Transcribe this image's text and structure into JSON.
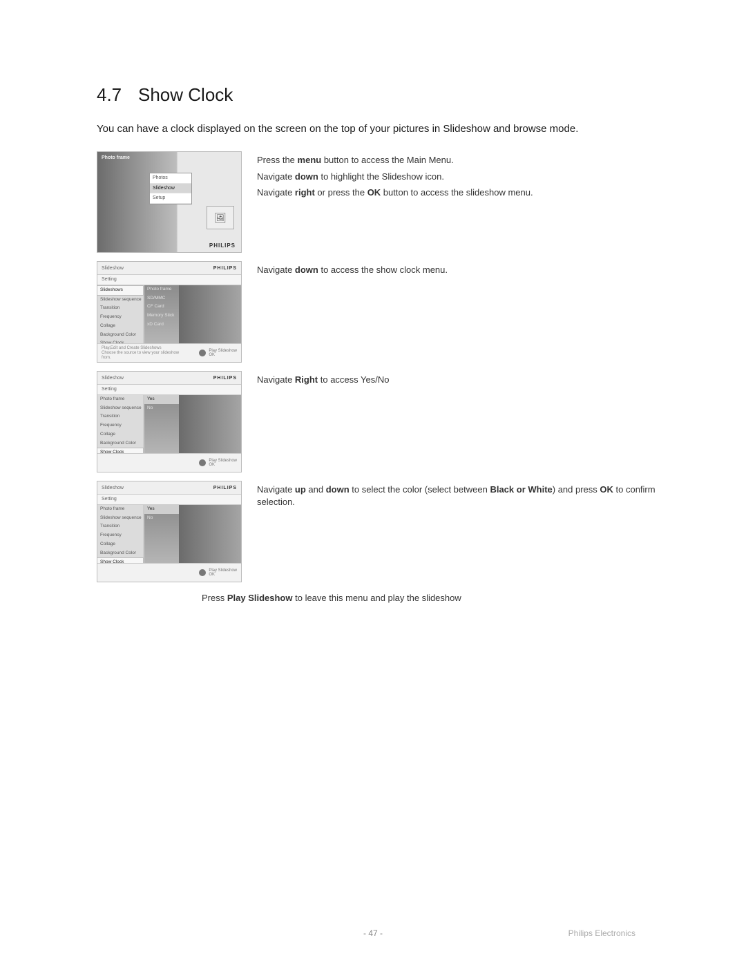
{
  "page": {
    "section_number": "4.7",
    "section_title": "Show Clock",
    "page_number": "- 47 -",
    "brand_footer": "Philips Electronics"
  },
  "intro": "You can have a clock displayed on the screen on the top of your pictures in Slideshow and browse mode.",
  "step1": {
    "l1a": "Press the ",
    "l1b": "menu",
    "l1c": " button to access the Main Menu.",
    "l2a": "Navigate ",
    "l2b": "down",
    "l2c": " to highlight the Slideshow icon.",
    "l3a": "Navigate ",
    "l3b": "right",
    "l3c": " or press the ",
    "l3d": "OK",
    "l3e": " button to access the slideshow menu."
  },
  "step2": {
    "a": "Navigate ",
    "b": "down",
    "c": " to access the show clock menu."
  },
  "step3": {
    "a": "Navigate ",
    "b": "Right",
    "c": " to access Yes/No"
  },
  "step4": {
    "a": "Navigate ",
    "b": "up",
    "c": " and ",
    "d": "down",
    "e": " to select the color (select between ",
    "f": "Black or White",
    "g": ") and press ",
    "h": "OK",
    "i": " to confirm selection."
  },
  "press_play": {
    "a": "Press ",
    "b": "Play Slideshow",
    "c": " to leave this menu and play the slideshow"
  },
  "ui": {
    "brand": "PHILIPS",
    "main_header": "Photo frame",
    "main_menu": [
      "Photos",
      "Slideshow",
      "Setup"
    ],
    "slideshow_label": "Slideshow",
    "setting_label": "Setting",
    "left_items": [
      "Slideshows",
      "Slideshow sequence",
      "Transition",
      "Frequency",
      "Collage",
      "Background Color",
      "Show Clock"
    ],
    "left_items_b": [
      "Photo frame",
      "Slideshow sequence",
      "Transition",
      "Frequency",
      "Collage",
      "Background Color",
      "Show Clock"
    ],
    "mid_sources": [
      "Photo frame",
      "SD/MMC",
      "CF Card",
      "Memory Stick",
      "xD Card"
    ],
    "yes_no": [
      "Yes",
      "No"
    ],
    "hint1": "Play,Edit and Create Slideshows",
    "hint2": "Choose the source to view your slideshow from.",
    "play_label": "Play Slideshow",
    "ok_label": "OK"
  }
}
